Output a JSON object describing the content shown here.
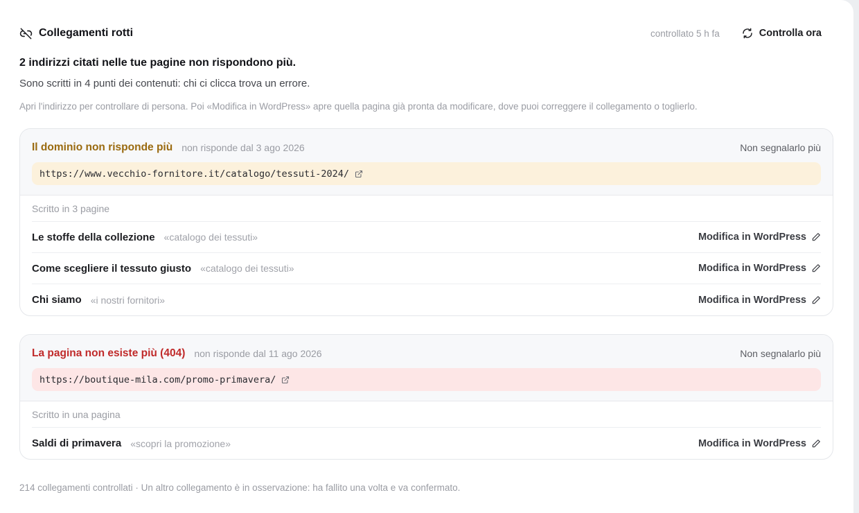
{
  "header": {
    "title": "Collegamenti rotti",
    "checked": "controllato 5 h fa",
    "check_now": "Controlla ora"
  },
  "summary": {
    "headline": "2 indirizzi citati nelle tue pagine non rispondono più.",
    "sub": "Sono scritti in 4 punti dei contenuti: chi ci clicca trova un errore.",
    "hint": "Apri l'indirizzo per controllare di persona. Poi «Modifica in WordPress» apre quella pagina già pronta da modificare, dove puoi correggere il collegamento o toglierlo."
  },
  "colors": {
    "amber_title": "#9a6a0f",
    "amber_bg": "#fcf1dc",
    "red_title": "#c02a2a",
    "red_bg": "#fde6e6"
  },
  "issues": [
    {
      "title": "Il dominio non risponde più",
      "since": "non risponde dal 3 ago 2026",
      "dismiss": "Non segnalarlo più",
      "url": "https://www.vecchio-fornitore.it/catalogo/tessuti-2024/",
      "written_in": "Scritto in 3 pagine",
      "pages": [
        {
          "name": "Le stoffe della collezione",
          "anchor": "«catalogo dei tessuti»",
          "edit": "Modifica in WordPress"
        },
        {
          "name": "Come scegliere il tessuto giusto",
          "anchor": "«catalogo dei tessuti»",
          "edit": "Modifica in WordPress"
        },
        {
          "name": "Chi siamo",
          "anchor": "«i nostri fornitori»",
          "edit": "Modifica in WordPress"
        }
      ]
    },
    {
      "title": "La pagina non esiste più (404)",
      "since": "non risponde dal 11 ago 2026",
      "dismiss": "Non segnalarlo più",
      "url": "https://boutique-mila.com/promo-primavera/",
      "written_in": "Scritto in una pagina",
      "pages": [
        {
          "name": "Saldi di primavera",
          "anchor": "«scopri la promozione»",
          "edit": "Modifica in WordPress"
        }
      ]
    }
  ],
  "footer": "214 collegamenti controllati · Un altro collegamento è in osservazione: ha fallito una volta e va confermato."
}
